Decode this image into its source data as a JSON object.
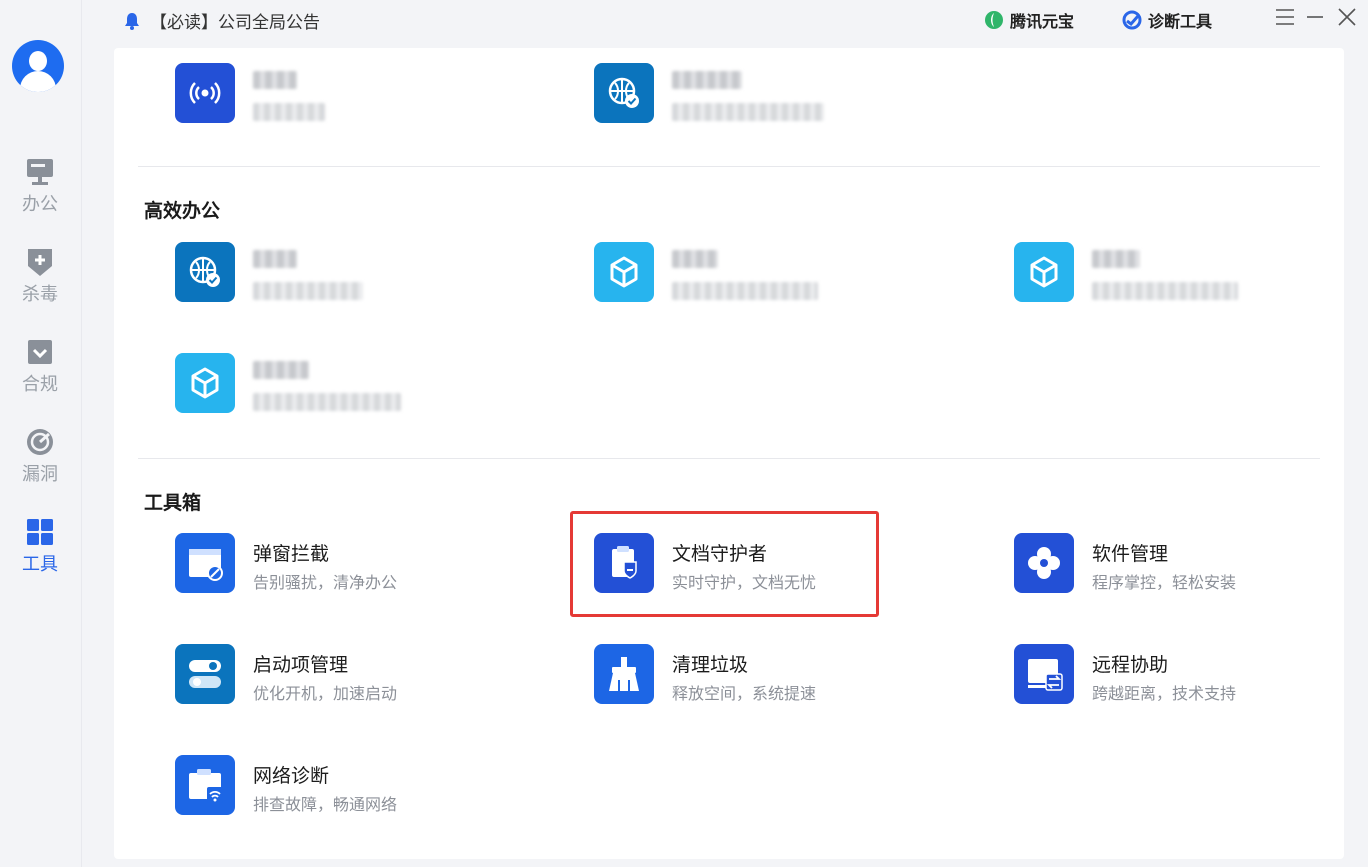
{
  "notice": {
    "text": "【必读】公司全局公告",
    "icon": "bell-icon"
  },
  "top_links": {
    "yuanbao": "腾讯元宝",
    "diagnose": "诊断工具"
  },
  "sidebar": {
    "items": [
      {
        "label": "办公",
        "icon": "monitor-icon"
      },
      {
        "label": "杀毒",
        "icon": "shield-plus-icon"
      },
      {
        "label": "合规",
        "icon": "check-box-icon"
      },
      {
        "label": "漏洞",
        "icon": "radar-icon"
      },
      {
        "label": "工具",
        "icon": "grid-icon",
        "active": true
      }
    ]
  },
  "sections": {
    "office": {
      "title": "高效办公"
    },
    "toolbox": {
      "title": "工具箱",
      "items": [
        {
          "title": "弹窗拦截",
          "desc": "告别骚扰，清净办公",
          "icon": "popup-block-icon"
        },
        {
          "title": "文档守护者",
          "desc": "实时守护，文档无忧",
          "icon": "document-guard-icon"
        },
        {
          "title": "软件管理",
          "desc": "程序掌控，轻松安装",
          "icon": "software-manage-icon"
        },
        {
          "title": "启动项管理",
          "desc": "优化开机，加速启动",
          "icon": "startup-toggle-icon"
        },
        {
          "title": "清理垃圾",
          "desc": "释放空间，系统提速",
          "icon": "broom-icon"
        },
        {
          "title": "远程协助",
          "desc": "跨越距离，技术支持",
          "icon": "remote-screen-icon"
        },
        {
          "title": "网络诊断",
          "desc": "排查故障，畅通网络",
          "icon": "network-diagnose-icon"
        }
      ]
    }
  },
  "colors": {
    "accent": "#2a66e8",
    "highlight": "#e53935",
    "icon_blue": "#1d66e5",
    "icon_cyan": "#27b4ee"
  }
}
